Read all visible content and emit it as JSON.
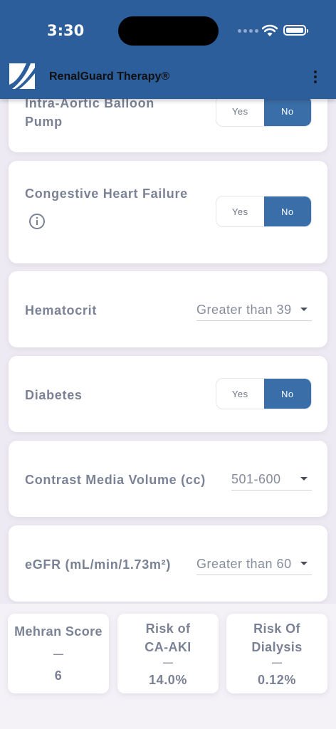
{
  "status_bar": {
    "time": "3:30"
  },
  "app_bar": {
    "title": "RenalGuard Therapy®"
  },
  "form": {
    "iabp": {
      "label": "Intra-Aortic Balloon Pump",
      "yes": "Yes",
      "no": "No",
      "selected": "No"
    },
    "chf": {
      "label": "Congestive Heart Failure",
      "yes": "Yes",
      "no": "No",
      "selected": "No"
    },
    "hematocrit": {
      "label": "Hematocrit",
      "value": "Greater than 39"
    },
    "diabetes": {
      "label": "Diabetes",
      "yes": "Yes",
      "no": "No",
      "selected": "No"
    },
    "contrast": {
      "label": "Contrast Media Volume (cc)",
      "value": "501-600"
    },
    "egfr": {
      "label": "eGFR (mL/min/1.73m²)",
      "value": "Greater than 60"
    }
  },
  "results": {
    "mehran": {
      "title": "Mehran Score",
      "dash": "—",
      "value": "6"
    },
    "risk_caki": {
      "title": "Risk of CA-AKI",
      "dash": "—",
      "value": "14.0%"
    },
    "risk_dialysis": {
      "title": "Risk Of Dialysis",
      "dash": "—",
      "value": "0.12%"
    }
  },
  "colors": {
    "header": "#2d5e9c",
    "selected_toggle": "#3a6ea8",
    "label_text": "#7b8295",
    "background": "#eeeaf3"
  },
  "icons": {
    "menu": "kebab-menu-icon",
    "info": "info-icon",
    "dropdown": "caret-down-icon",
    "wifi": "wifi-icon",
    "battery": "battery-icon",
    "logo": "renalguard-logo"
  }
}
